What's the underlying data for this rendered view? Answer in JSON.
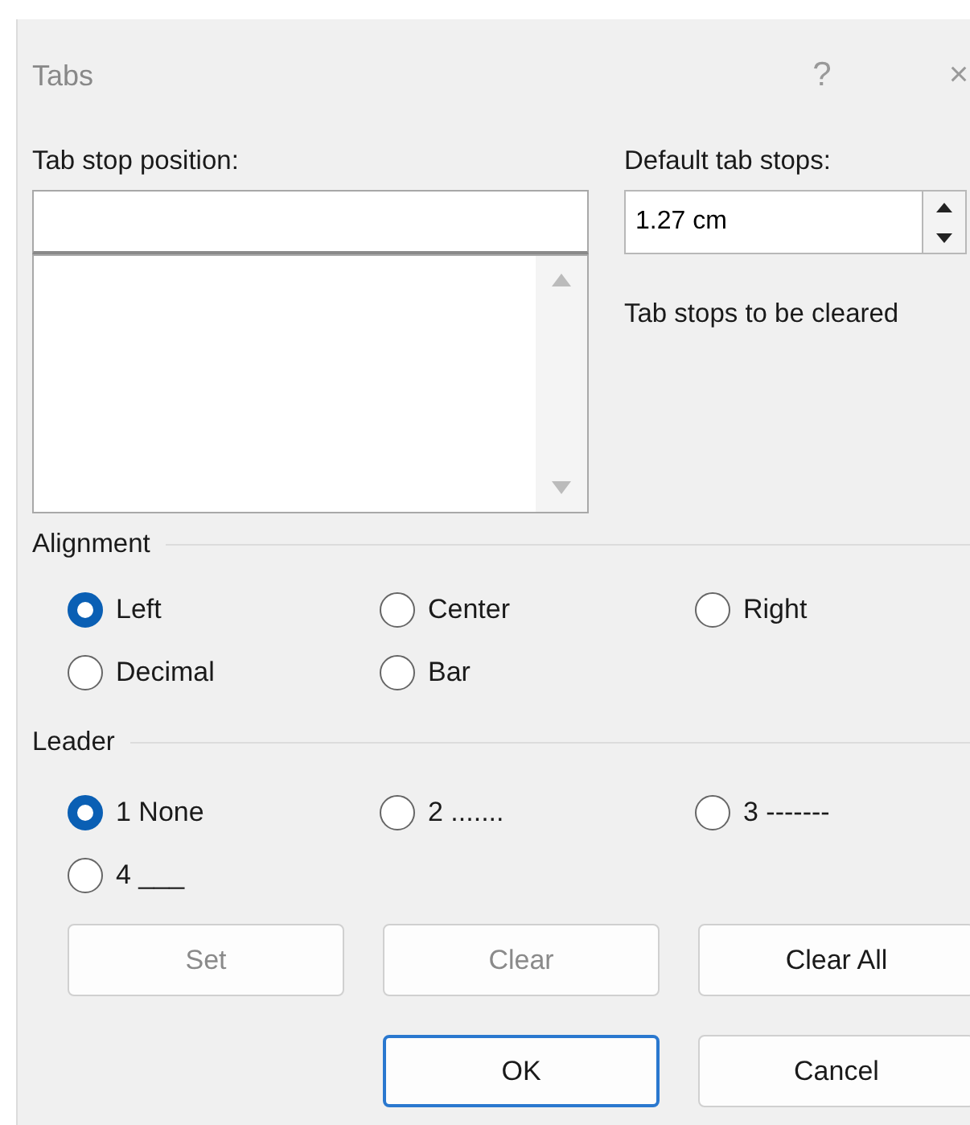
{
  "window": {
    "title": "Tabs",
    "help": "?",
    "close": "×"
  },
  "tab_stop_position": {
    "label": "Tab stop position:"
  },
  "default_tab_stops": {
    "label": "Default tab stops:",
    "value": "1.27 cm"
  },
  "tab_stops_to_be_cleared": {
    "label": "Tab stops to be cleared"
  },
  "alignment": {
    "heading": "Alignment",
    "options": [
      {
        "label": "Left",
        "selected": true
      },
      {
        "label": "Center",
        "selected": false
      },
      {
        "label": "Right",
        "selected": false
      },
      {
        "label": "Decimal",
        "selected": false
      },
      {
        "label": "Bar",
        "selected": false
      }
    ]
  },
  "leader": {
    "heading": "Leader",
    "options": [
      {
        "label": "1 None",
        "selected": true
      },
      {
        "label": "2 .......",
        "selected": false
      },
      {
        "label": "3 -------",
        "selected": false
      },
      {
        "label": "4 ___",
        "selected": false
      }
    ]
  },
  "buttons": [
    {
      "label": "Set",
      "disabled": true
    },
    {
      "label": "Clear",
      "disabled": true
    },
    {
      "label": "Clear All",
      "disabled": false
    }
  ],
  "footer_buttons": [
    {
      "label": "OK",
      "default": true
    },
    {
      "label": "Cancel",
      "default": false
    }
  ]
}
